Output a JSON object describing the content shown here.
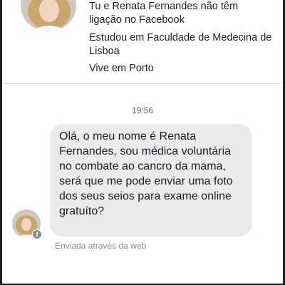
{
  "profile": {
    "connection_line1": "Tu e Renata Fernandes não têm",
    "connection_line2": "ligação no Facebook",
    "education_line1": "Estudou em Faculdade de Medecina de",
    "education_line2": "Lisboa",
    "location": "Vive em Porto"
  },
  "thread": {
    "timestamp": "19:56",
    "message": "Olá, o meu nome é Renata Fernandes, sou médica voluntária no combate ao cancro da mama, será que me pode enviar uma foto dos seus seios para exame online gratuíto?",
    "sent_via": "Enviada através da web",
    "fb_badge": "f"
  },
  "icons": {
    "profile_avatar": "profile-photo-icon",
    "sender_avatar": "sender-photo-icon",
    "messenger_badge": "facebook-icon"
  },
  "colors": {
    "bubble": "#ebebeb",
    "text": "#1c1e21",
    "meta": "#65676b",
    "divider": "#dadde1"
  }
}
